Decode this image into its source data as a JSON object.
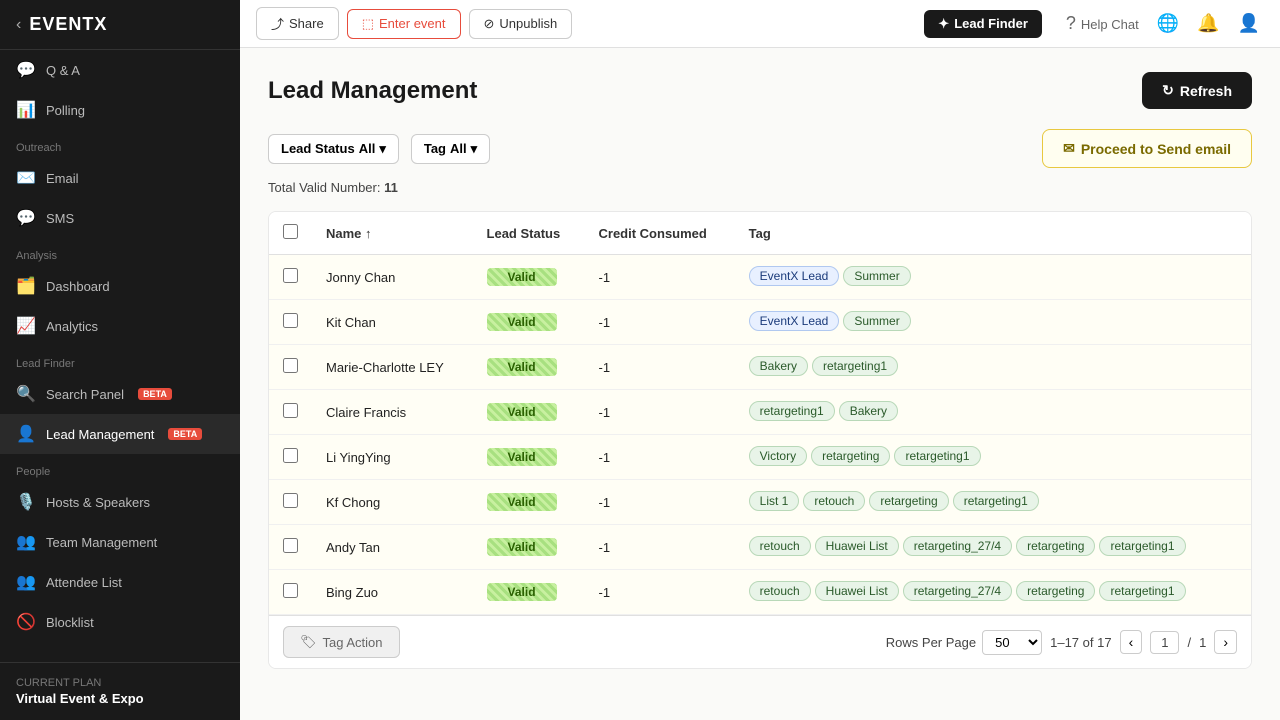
{
  "app": {
    "logo": "EVENTX",
    "back_arrow": "‹"
  },
  "top_nav": {
    "share_label": "Share",
    "enter_event_label": "Enter event",
    "unpublish_label": "Unpublish",
    "lead_finder_label": "Lead Finder",
    "help_chat_label": "Help Chat"
  },
  "sidebar": {
    "sections": [
      {
        "label": "",
        "items": [
          {
            "id": "qa",
            "icon": "💬",
            "label": "Q & A",
            "active": false
          },
          {
            "id": "polling",
            "icon": "📊",
            "label": "Polling",
            "active": false
          }
        ]
      },
      {
        "label": "Outreach",
        "items": [
          {
            "id": "email",
            "icon": "✉️",
            "label": "Email",
            "active": false
          },
          {
            "id": "sms",
            "icon": "💬",
            "label": "SMS",
            "active": false
          }
        ]
      },
      {
        "label": "Analysis",
        "items": [
          {
            "id": "dashboard",
            "icon": "🗂️",
            "label": "Dashboard",
            "active": false
          },
          {
            "id": "analytics",
            "icon": "📈",
            "label": "Analytics",
            "active": false
          }
        ]
      },
      {
        "label": "Lead Finder",
        "items": [
          {
            "id": "search-panel",
            "icon": "🔍",
            "label": "Search Panel",
            "active": false,
            "beta": true
          },
          {
            "id": "lead-management",
            "icon": "👤",
            "label": "Lead Management",
            "active": true,
            "beta": true
          }
        ]
      },
      {
        "label": "People",
        "items": [
          {
            "id": "hosts-speakers",
            "icon": "🎙️",
            "label": "Hosts & Speakers",
            "active": false
          },
          {
            "id": "team-management",
            "icon": "👥",
            "label": "Team Management",
            "active": false
          },
          {
            "id": "attendee-list",
            "icon": "👥",
            "label": "Attendee List",
            "active": false
          },
          {
            "id": "blocklist",
            "icon": "🚫",
            "label": "Blocklist",
            "active": false
          }
        ]
      }
    ],
    "current_plan_label": "CURRENT PLAN",
    "plan_name": "Virtual Event & Expo"
  },
  "page": {
    "title": "Lead Management",
    "refresh_label": "Refresh",
    "filters": {
      "lead_status_label": "Lead Status",
      "lead_status_value": "All",
      "tag_label": "Tag",
      "tag_value": "All"
    },
    "send_email_label": "Proceed to Send email",
    "total_valid_label": "Total Valid Number:",
    "total_valid_value": "11"
  },
  "table": {
    "columns": [
      {
        "id": "name",
        "label": "Name"
      },
      {
        "id": "lead_status",
        "label": "Lead Status"
      },
      {
        "id": "credit_consumed",
        "label": "Credit Consumed"
      },
      {
        "id": "tag",
        "label": "Tag"
      }
    ],
    "rows": [
      {
        "name": "Jonny Chan",
        "lead_status": "Valid",
        "credit_consumed": "-1",
        "tags": [
          {
            "label": "EventX Lead",
            "type": "eventx"
          },
          {
            "label": "Summer",
            "type": "normal"
          }
        ]
      },
      {
        "name": "Kit Chan",
        "lead_status": "Valid",
        "credit_consumed": "-1",
        "tags": [
          {
            "label": "EventX Lead",
            "type": "eventx"
          },
          {
            "label": "Summer",
            "type": "normal"
          }
        ]
      },
      {
        "name": "Marie-Charlotte LEY",
        "lead_status": "Valid",
        "credit_consumed": "-1",
        "tags": [
          {
            "label": "Bakery",
            "type": "normal"
          },
          {
            "label": "retargeting1",
            "type": "normal"
          }
        ]
      },
      {
        "name": "Claire Francis",
        "lead_status": "Valid",
        "credit_consumed": "-1",
        "tags": [
          {
            "label": "retargeting1",
            "type": "normal"
          },
          {
            "label": "Bakery",
            "type": "normal"
          }
        ]
      },
      {
        "name": "Li YingYing",
        "lead_status": "Valid",
        "credit_consumed": "-1",
        "tags": [
          {
            "label": "Victory",
            "type": "normal"
          },
          {
            "label": "retargeting",
            "type": "normal"
          },
          {
            "label": "retargeting1",
            "type": "normal"
          }
        ]
      },
      {
        "name": "Kf Chong",
        "lead_status": "Valid",
        "credit_consumed": "-1",
        "tags": [
          {
            "label": "List 1",
            "type": "normal"
          },
          {
            "label": "retouch",
            "type": "normal"
          },
          {
            "label": "retargeting",
            "type": "normal"
          },
          {
            "label": "retargeting1",
            "type": "normal"
          }
        ]
      },
      {
        "name": "Andy Tan",
        "lead_status": "Valid",
        "credit_consumed": "-1",
        "tags": [
          {
            "label": "retouch",
            "type": "normal"
          },
          {
            "label": "Huawei List",
            "type": "normal"
          },
          {
            "label": "retargeting_27/4",
            "type": "normal"
          },
          {
            "label": "retargeting",
            "type": "normal"
          },
          {
            "label": "retargeting1",
            "type": "normal"
          }
        ]
      },
      {
        "name": "Bing Zuo",
        "lead_status": "Valid",
        "credit_consumed": "-1",
        "tags": [
          {
            "label": "retouch",
            "type": "normal"
          },
          {
            "label": "Huawei List",
            "type": "normal"
          },
          {
            "label": "retargeting_27/4",
            "type": "normal"
          },
          {
            "label": "retargeting",
            "type": "normal"
          },
          {
            "label": "retargeting1",
            "type": "normal"
          }
        ]
      }
    ]
  },
  "footer": {
    "tag_action_label": "Tag Action",
    "rows_per_page_label": "Rows Per Page",
    "rows_per_page_value": "50",
    "pagination_info": "1–17 of 17",
    "page_current": "1",
    "page_total": "1"
  }
}
